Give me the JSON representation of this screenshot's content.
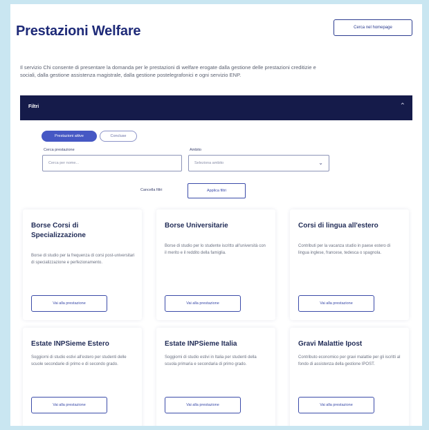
{
  "header": {
    "title": "Prestazioni Welfare",
    "top_button_label": "Cerca nel homepage"
  },
  "intro_text": "Il servizio Chi consente di presentare la domanda per le prestazioni di welfare erogate dalla gestione delle prestazioni creditizie e sociali, dalla gestione assistenza magistrale, dalla gestione postelegrafonici e ogni servizio ENP.",
  "filter_bar": {
    "label": "Filtri",
    "chevron_icon": "chevron-up-icon"
  },
  "tabs": [
    {
      "label": "Prestazioni attive",
      "active": true
    },
    {
      "label": "Concluse",
      "active": false
    }
  ],
  "fields": {
    "search_label": "Cerca prestazione",
    "search_placeholder": "Cerca per nome...",
    "status_label": "Ambito",
    "status_value": "Seleziona ambito"
  },
  "reset": {
    "label": "Cancella filtri",
    "button_label": "Applica filtri"
  },
  "cards": [
    {
      "title": "Borse Corsi di Specializzazione",
      "desc": "Borse di studio per la frequenza di corsi post-universitari di specializzazione e perfezionamento.",
      "button": "Vai alla prestazione"
    },
    {
      "title": "Borse Universitarie",
      "desc": "Borse di studio per lo studente iscritto all'università con il merito e il reddito della famiglia.",
      "button": "Vai alla prestazione"
    },
    {
      "title": "Corsi di lingua all'estero",
      "desc": "Contributi per la vacanza studio in paese estero di lingua inglese, francese, tedesca o spagnola.",
      "button": "Vai alla prestazione"
    },
    {
      "title": "Estate INPSieme Estero",
      "desc": "Soggiorni di studio estivi all'estero per studenti delle scuole secondarie di primo e di secondo grado.",
      "button": "Vai alla prestazione"
    },
    {
      "title": "Estate INPSieme Italia",
      "desc": "Soggiorni di studio estivi in Italia per studenti della scuola primaria e secondaria di primo grado.",
      "button": "Vai alla prestazione"
    },
    {
      "title": "Gravi Malattie Ipost",
      "desc": "Contributo economico per gravi malattie per gli iscritti al fondo di assistenza della gestione IPOST.",
      "button": "Vai alla prestazione"
    }
  ]
}
